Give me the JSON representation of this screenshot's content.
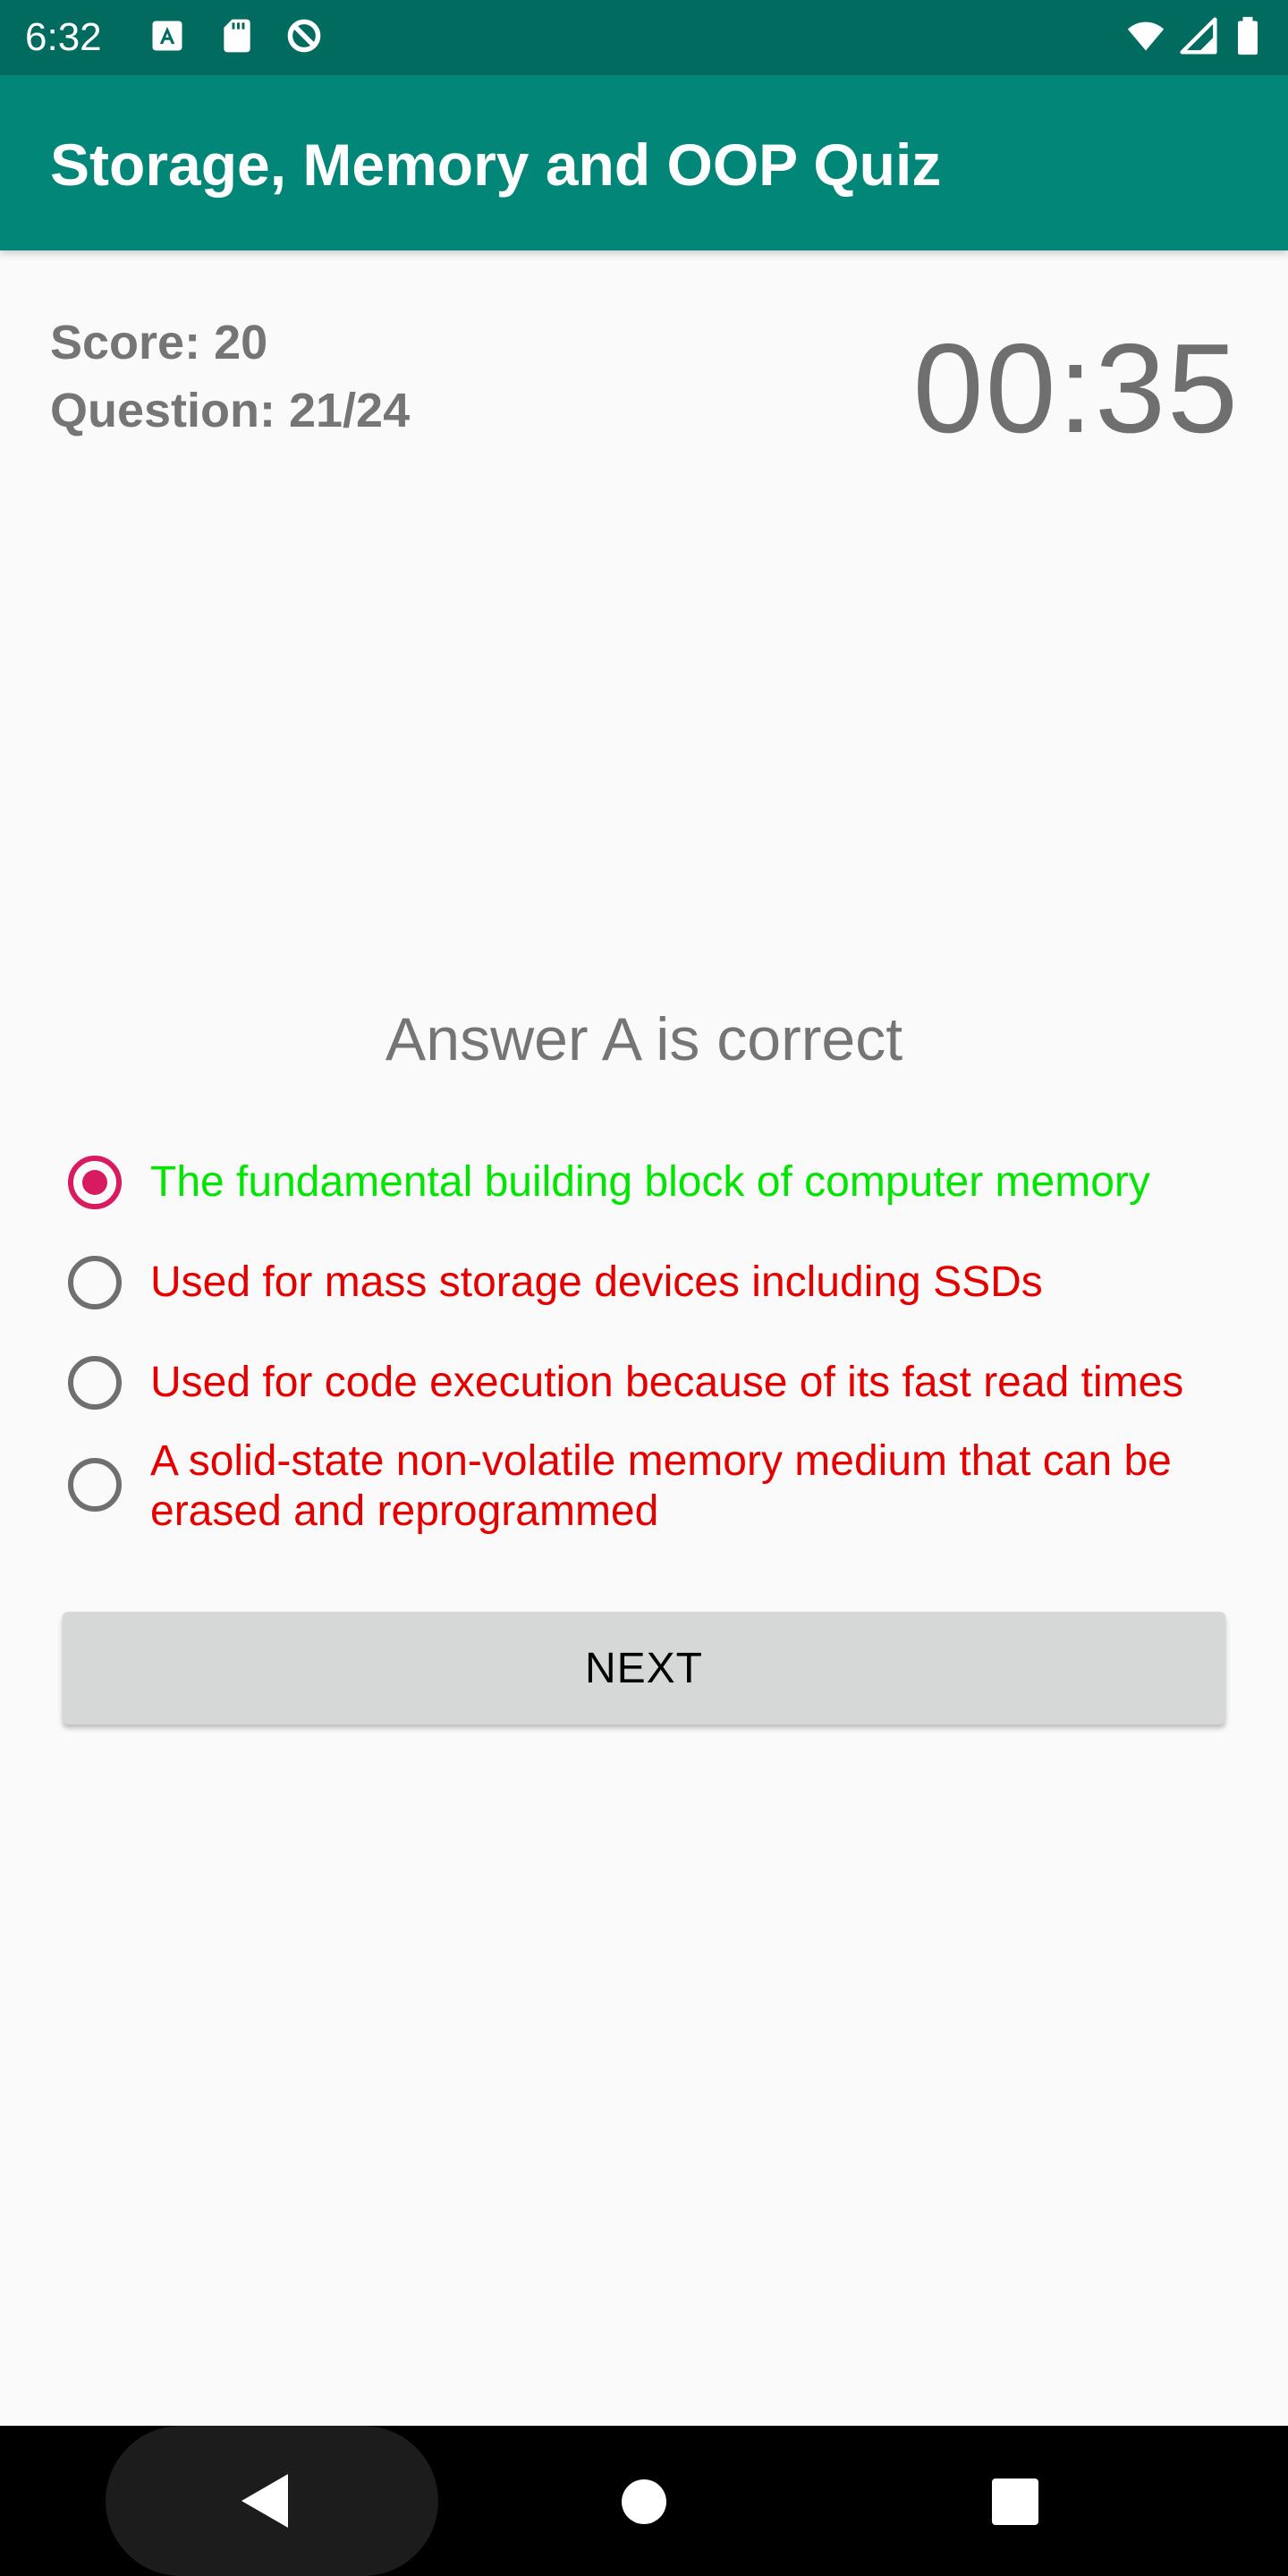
{
  "status_bar": {
    "time": "6:32",
    "icons_left": [
      "a-box-icon",
      "sd-card-icon",
      "data-saver-icon"
    ],
    "icons_right": [
      "wifi-icon",
      "cell-signal-icon",
      "battery-icon"
    ]
  },
  "app_bar": {
    "title": "Storage, Memory and OOP Quiz"
  },
  "quiz": {
    "score": "Score: 20",
    "question": "Question: 21/24",
    "timer": "00:35",
    "feedback": "Answer A is correct",
    "options": [
      {
        "text": "The fundamental building block of computer memory",
        "selected": true,
        "color": "#00e600"
      },
      {
        "text": "Used for mass storage devices including SSDs",
        "selected": false,
        "color": "#e50000"
      },
      {
        "text": "Used for code execution because of its fast read times",
        "selected": false,
        "color": "#e50000"
      },
      {
        "text": "A solid-state non-volatile memory medium that can be erased and reprogrammed",
        "selected": false,
        "color": "#e50000"
      }
    ],
    "next_label": "NEXT"
  },
  "nav_bar": {
    "icons": [
      "back-icon",
      "home-icon",
      "recents-icon"
    ]
  },
  "colors": {
    "status_bar": "#016b5f",
    "app_bar": "#018677",
    "accent": "#d81b60",
    "correct": "#00e600",
    "wrong": "#e50000"
  }
}
